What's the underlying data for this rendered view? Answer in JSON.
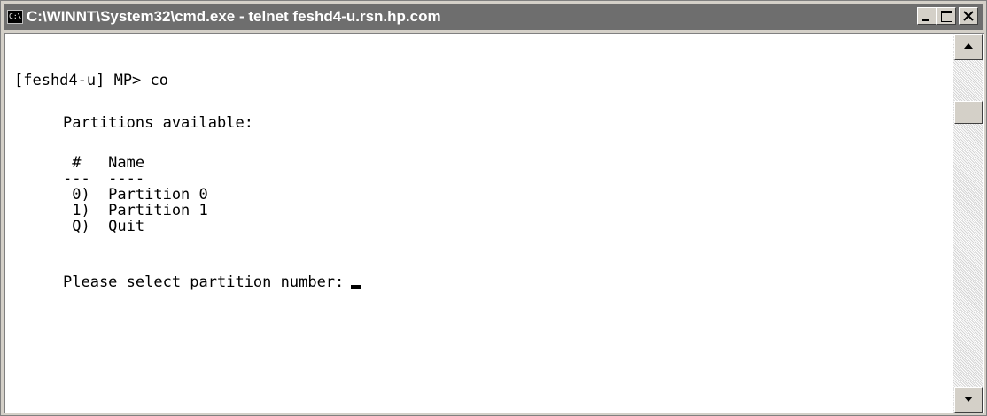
{
  "window": {
    "title": "C:\\WINNT\\System32\\cmd.exe - telnet feshd4-u.rsn.hp.com",
    "icon": "console-icon",
    "icon_glyph": "C:\\"
  },
  "console": {
    "prompt_line": "[feshd4-u] MP> co",
    "heading": "Partitions available:",
    "table": {
      "header": " #   Name",
      "divider": "---  ----",
      "rows": [
        " 0)  Partition 0",
        " 1)  Partition 1",
        " Q)  Quit"
      ]
    },
    "selection_prompt": "Please select partition number:"
  },
  "colors": {
    "titlebar": "#6e6e6e",
    "console_background": "#ffffff",
    "console_text": "#000000",
    "chrome": "#d4d0c8"
  }
}
